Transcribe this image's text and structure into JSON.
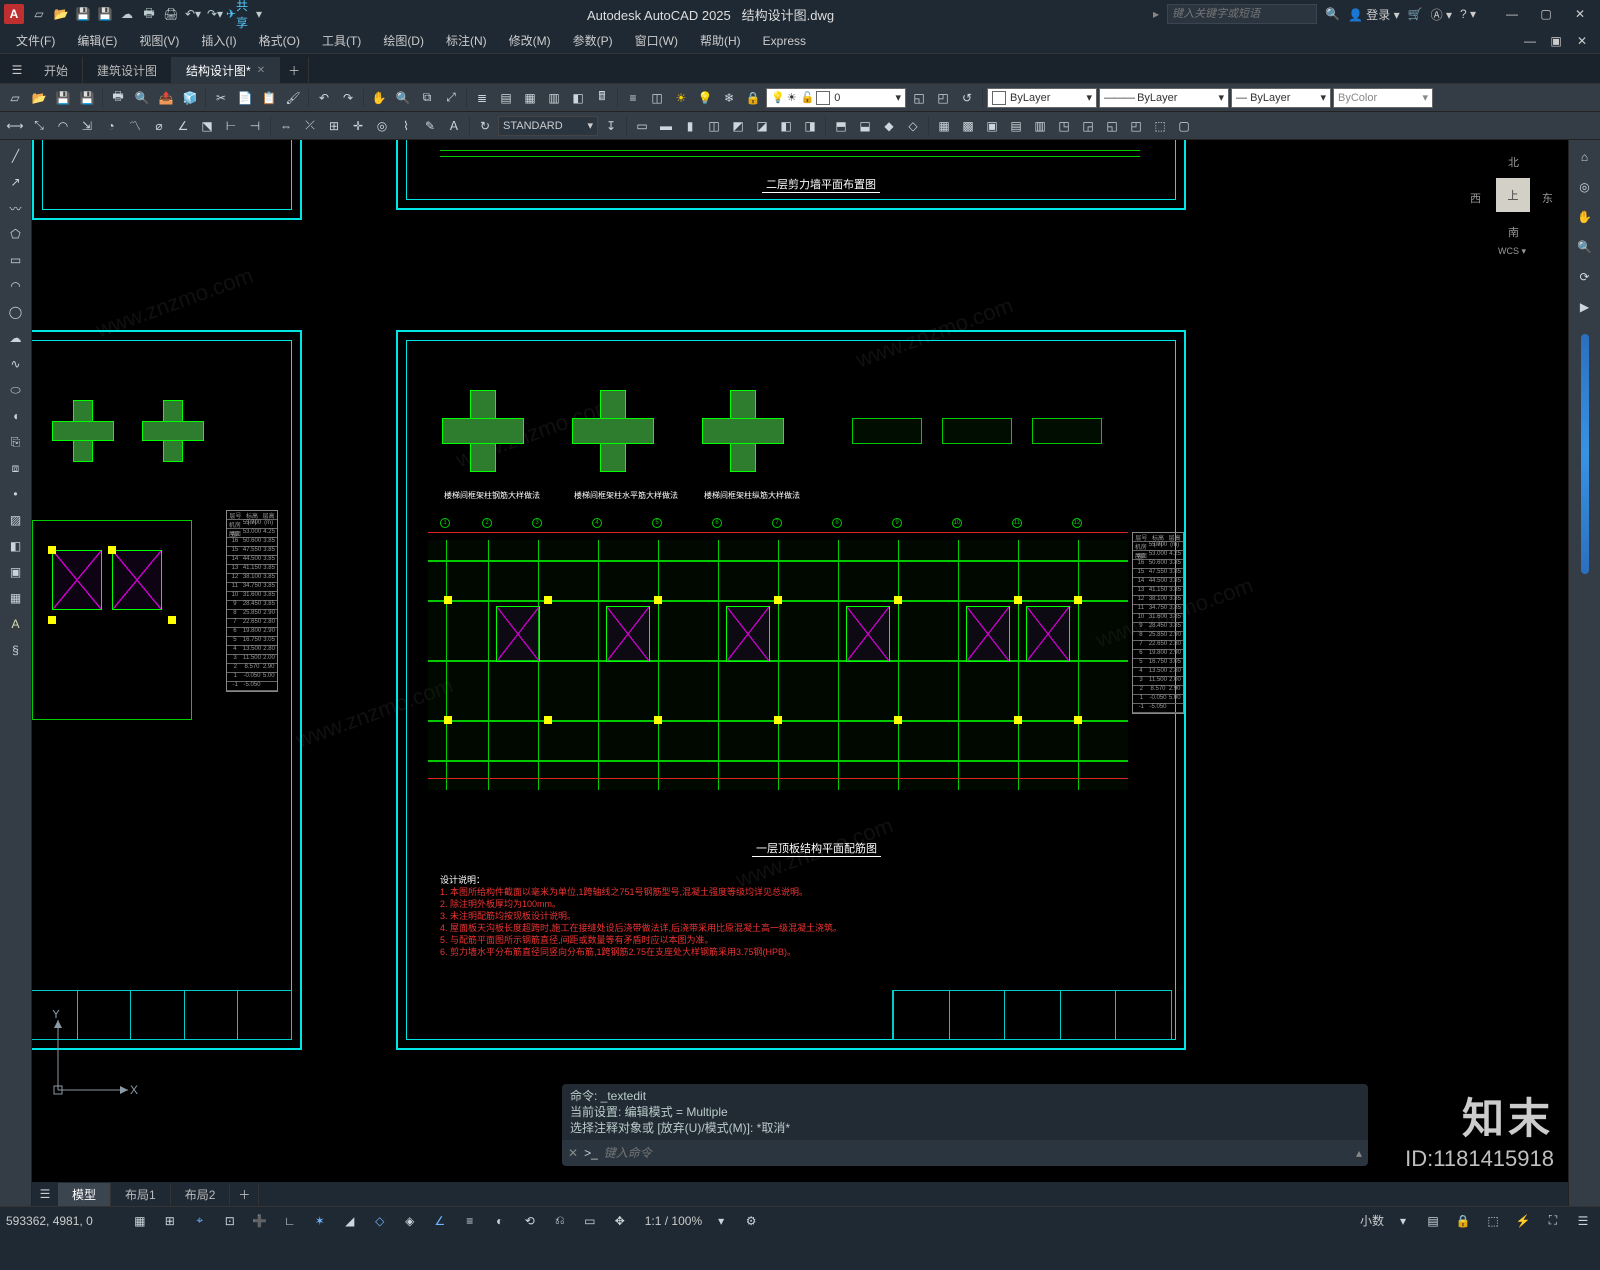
{
  "app": {
    "title_prefix": "Autodesk AutoCAD 2025",
    "doc_name": "结构设计图.dwg",
    "logo_letter": "A"
  },
  "qat_icons": [
    "new-icon",
    "open-icon",
    "save-icon",
    "saveas-icon",
    "cloud-icon",
    "plot-icon",
    "publish-icon",
    "print-icon",
    "undo-icon",
    "redo-icon"
  ],
  "share_label": "共享",
  "search_placeholder": "键入关键字或短语",
  "login_label": "登录",
  "menus": [
    "文件(F)",
    "编辑(E)",
    "视图(V)",
    "插入(I)",
    "格式(O)",
    "工具(T)",
    "绘图(D)",
    "标注(N)",
    "修改(M)",
    "参数(P)",
    "窗口(W)",
    "帮助(H)",
    "Express"
  ],
  "file_tabs": [
    {
      "label": "开始",
      "active": false
    },
    {
      "label": "建筑设计图",
      "active": false
    },
    {
      "label": "结构设计图*",
      "active": true
    }
  ],
  "toolbar1_icons_left": [
    "new",
    "open",
    "save",
    "qsave",
    "sep",
    "plot",
    "preview",
    "publish",
    "sep",
    "cut",
    "copy",
    "paste",
    "sep",
    "matchprop",
    "undo",
    "redo",
    "sep",
    "pan",
    "zoom-rt",
    "zoom-win",
    "zoom-ext",
    "sep",
    "props",
    "sheet",
    "tool-pal",
    "calc",
    "sep",
    "tb1",
    "tb2",
    "tb3",
    "tb4",
    "tb5",
    "tb6",
    "sep",
    "tb7",
    "tb8",
    "sun",
    "bulb",
    "lock"
  ],
  "layer_combo": {
    "value": "0",
    "swatch": "#ffffff"
  },
  "layer_icons_right": [
    "layiso",
    "layunis",
    "layerp"
  ],
  "props_linetype": "ByLayer",
  "props_lineweight": "ByLayer",
  "props_color": "ByColor",
  "toolbar2_icons": [
    "line",
    "pline",
    "rect",
    "arc",
    "circle",
    "spline",
    "ell",
    "hatch",
    "sep",
    "dimlayer",
    "dimlin",
    "dimali",
    "dimrad",
    "dimdia",
    "dimang",
    "dimord",
    "dimcont",
    "sep",
    "text",
    "mtext",
    "table",
    "sep"
  ],
  "textstyle_combo": "STANDARD",
  "toolbar2_right": [
    "g1",
    "g2",
    "g3",
    "g4",
    "g5",
    "g6",
    "g7",
    "g8",
    "g9",
    "g10",
    "sep",
    "g11",
    "g12",
    "g13",
    "g14",
    "sep",
    "g15",
    "g16",
    "g17",
    "g18",
    "g19",
    "g20",
    "g21",
    "g22",
    "g23",
    "g24",
    "g25",
    "g26"
  ],
  "left_tools": [
    "line",
    "pline",
    "polyg",
    "rect",
    "arc",
    "circle",
    "revc",
    "spline",
    "ellipse",
    "earc",
    "ins",
    "block",
    "hatch",
    "grad",
    "region",
    "table",
    "point",
    "mtext",
    "sep",
    "move",
    "copy",
    "stretch",
    "rotate",
    "mirror",
    "scale",
    "trim",
    "extend",
    "fillet",
    "array"
  ],
  "right_tools": [
    "viewcube",
    "nav",
    "orbit",
    "pan",
    "zoom",
    "sep"
  ],
  "viewcube": {
    "top": "上",
    "n": "北",
    "s": "南",
    "e": "东",
    "w": "西",
    "wcs": "WCS"
  },
  "drawing_titles": {
    "upper_plan": "二层剪力墙平面布置图",
    "lower_plan": "一层顶板结构平面配筋图",
    "note_header": "设计说明：",
    "detail1": "楼梯间框架柱钢筋大样做法",
    "detail2": "楼梯间框架柱水平筋大样做法",
    "detail3": "楼梯间框架柱纵筋大样做法"
  },
  "notes": [
    "1. 本图所给构件截面以毫米为单位,1跨轴线之751号钢筋型号,混凝土强度等级均详见总说明。",
    "2. 除注明外板厚均为100mm。",
    "3. 未注明配筋均按现板设计说明。",
    "4. 屋面板天沟板长度超跨时,施工在接缝处设后浇带做法详,后浇带采用比原混凝土高一级混凝土浇筑。",
    "5. 与配筋平面图所示钢筋直径,间距或数量等有矛盾时应以本图为准。",
    "6. 剪力墙水平分布筋直径同竖向分布筋,1跨钢筋2.75在支座处大样钢筋采用3.75钢(HPB)。"
  ],
  "cmd": {
    "prev1": "命令: _textedit",
    "prev2": "当前设置: 编辑模式 = Multiple",
    "prev3": "选择注释对象或 [放弃(U)/模式(M)]: *取消*",
    "prompt_prefix": ">_",
    "placeholder": "键入命令"
  },
  "ucs_labels": {
    "x": "X",
    "y": "Y"
  },
  "model_tabs": [
    {
      "label": "模型",
      "active": true
    },
    {
      "label": "布局1",
      "active": false
    },
    {
      "label": "布局2",
      "active": false
    }
  ],
  "statusbar": {
    "coords": "593362, 4981, 0",
    "toggles": [
      "model",
      "grid",
      "snap",
      "infer",
      "dyn",
      "ortho",
      "polar",
      "isodraft",
      "osnap",
      "3do",
      "otrack",
      "lwt",
      "transp",
      "cycle",
      "dynucs",
      "sel",
      "gizmo",
      "annoscale",
      "annovis"
    ],
    "scale_text": "1:1 / 100%",
    "decimal_label": "小数",
    "right_icons": [
      "gear",
      "max",
      "clean",
      "custom"
    ]
  },
  "watermark": {
    "brand": "知末",
    "id_label": "ID:",
    "id": "1181415918",
    "diag": "www.znzmo.com"
  },
  "elev_rows_main": [
    [
      "层号",
      "标高(m)",
      "层高(m)"
    ],
    [
      "机房层",
      "55.700",
      ""
    ],
    [
      "屋面",
      "53.000",
      "4.25"
    ],
    [
      "16",
      "50.600",
      "3.85"
    ],
    [
      "15",
      "47.550",
      "3.85"
    ],
    [
      "14",
      "44.500",
      "3.85"
    ],
    [
      "13",
      "41.150",
      "3.85"
    ],
    [
      "12",
      "38.100",
      "3.85"
    ],
    [
      "11",
      "34.750",
      "3.85"
    ],
    [
      "10",
      "31.600",
      "3.85"
    ],
    [
      "9",
      "28.450",
      "3.85"
    ],
    [
      "8",
      "25.850",
      "2.90"
    ],
    [
      "7",
      "22.650",
      "2.80"
    ],
    [
      "6",
      "19.800",
      "2.90"
    ],
    [
      "5",
      "16.750",
      "3.05"
    ],
    [
      "4",
      "13.500",
      "2.80"
    ],
    [
      "3",
      "11.500",
      "2.00"
    ],
    [
      "2",
      "8.570",
      "2.90"
    ],
    [
      "1",
      "-0.050",
      "5.00"
    ],
    [
      "-1",
      "-5.050",
      ""
    ]
  ]
}
